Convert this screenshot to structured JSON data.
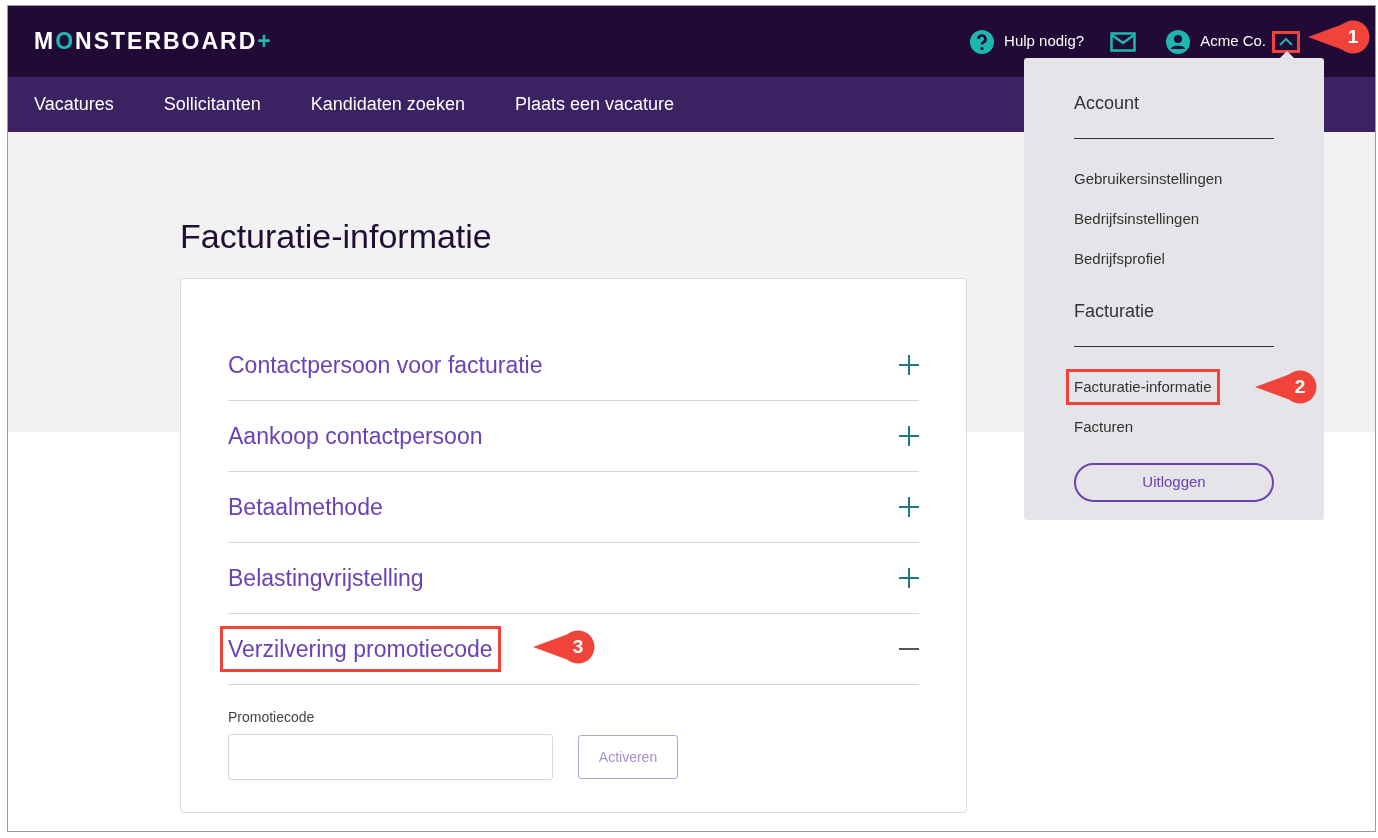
{
  "header": {
    "logo": "MONSTERBOARD+",
    "help": "Hulp nodig?",
    "account": "Acme Co.",
    "menu_open": true,
    "callout": "1"
  },
  "nav": [
    "Vacatures",
    "Sollicitanten",
    "Kandidaten zoeken",
    "Plaats een vacature"
  ],
  "page_title": "Facturatie-informatie",
  "sections": [
    {
      "title": "Contactpersoon voor facturatie",
      "expanded": false
    },
    {
      "title": "Aankoop contactpersoon",
      "expanded": false
    },
    {
      "title": "Betaalmethode",
      "expanded": false
    },
    {
      "title": "Belastingvrijstelling",
      "expanded": false
    },
    {
      "title": "Verzilvering promotiecode",
      "expanded": true,
      "callout": "3",
      "field_label": "Promotiecode",
      "button": "Activeren"
    }
  ],
  "account_menu": {
    "groups": [
      {
        "title": "Account",
        "items": [
          {
            "label": "Gebruikersinstellingen"
          },
          {
            "label": "Bedrijfsinstellingen"
          },
          {
            "label": "Bedrijfsprofiel"
          }
        ]
      },
      {
        "title": "Facturatie",
        "items": [
          {
            "label": "Facturatie-informatie",
            "callout": "2"
          },
          {
            "label": "Facturen"
          }
        ]
      }
    ],
    "button": "Uitloggen"
  }
}
